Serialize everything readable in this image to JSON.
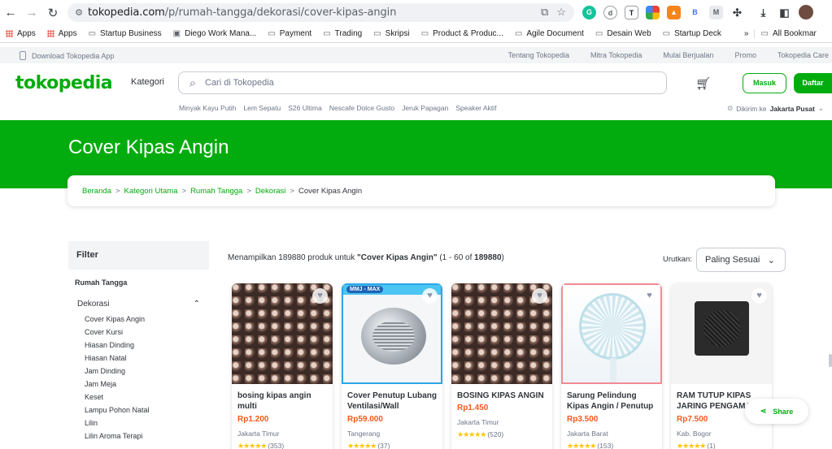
{
  "browser": {
    "url_host": "tokopedia.com",
    "url_path": "/p/rumah-tangga/dekorasi/cover-kipas-angin",
    "bookmarks": [
      "Apps",
      "Apps",
      "Startup Business",
      "Diego Work Mana...",
      "Payment",
      "Trading",
      "Skripsi",
      "Product & Produc...",
      "Agile Document",
      "Desain Web",
      "Startup Deck"
    ],
    "more_chevron": "»",
    "all_bookmarks": "All Bookmar",
    "ext_icons": [
      "grammarly-icon",
      "circle-icon",
      "tt-icon",
      "google-icon",
      "metamask-icon",
      "b-icon",
      "m-icon",
      "puzzle-icon"
    ]
  },
  "topstrip": {
    "download": "Download Tokopedia App",
    "links": [
      "Tentang Tokopedia",
      "Mitra Tokopedia",
      "Mulai Berjualan",
      "Promo",
      "Tokopedia Care"
    ]
  },
  "header": {
    "logo": "tokopedia",
    "kategori": "Kategori",
    "search_placeholder": "Cari di Tokopedia",
    "masuk": "Masuk",
    "daftar": "Daftar",
    "trending": [
      "Minyak Kayu Putih",
      "Lem Sepatu",
      "S26 Ultima",
      "Nescafe Dolce Gusto",
      "Jeruk Papagan",
      "Speaker Aktif"
    ],
    "dikirim_label": "Dikirim ke",
    "dikirim_location": "Jakarta Pusat"
  },
  "banner": {
    "title": "Cover Kipas Angin",
    "breadcrumb": [
      "Beranda",
      "Kategori Utama",
      "Rumah Tangga",
      "Dekorasi"
    ],
    "breadcrumb_current": "Cover Kipas Angin",
    "separator": ">"
  },
  "filter": {
    "title": "Filter",
    "category": "Rumah Tangga",
    "subcategory": "Dekorasi",
    "items": [
      "Cover Kipas Angin",
      "Cover Kursi",
      "Hiasan Dinding",
      "Hiasan Natal",
      "Jam Dinding",
      "Jam Meja",
      "Keset",
      "Lampu Pohon Natal",
      "Lilin",
      "Lilin Aroma Terapi"
    ]
  },
  "results": {
    "prefix": "Menampilkan 189880 produk untuk ",
    "query": "\"Cover Kipas Angin\"",
    "range_open": " (1 - 60 of ",
    "total": "189880",
    "range_close": ")",
    "sort_label": "Urutkan:",
    "sort_value": "Paling Sesuai"
  },
  "products": [
    {
      "name": "bosing kipas angin multi",
      "price": "Rp1.200",
      "location": "Jakarta Timur",
      "reviews": "(353)",
      "rating": 5
    },
    {
      "name": "Cover Penutup Lubang Ventilasi/Wall",
      "price": "Rp59.000",
      "location": "Tangerang",
      "reviews": "(37)",
      "rating": 5,
      "badge": "MMJ - MAX"
    },
    {
      "name": "BOSING KIPAS ANGIN",
      "price": "Rp1.450",
      "location": "Jakarta Timur",
      "reviews": "(520)",
      "rating": 5
    },
    {
      "name": "Sarung Pelindung Kipas Angin / Penutup",
      "price": "Rp3.500",
      "location": "Jakarta Barat",
      "reviews": "(153)",
      "rating": 5
    },
    {
      "name": "RAM TUTUP KIPAS JARING PENGAMAN",
      "price": "Rp7.500",
      "location": "Kab. Bogor",
      "reviews": "(1)",
      "rating": 5
    }
  ],
  "share": "Share",
  "colors": {
    "brand": "#03ac0e",
    "price": "#fa591d",
    "star": "#ffc400"
  }
}
